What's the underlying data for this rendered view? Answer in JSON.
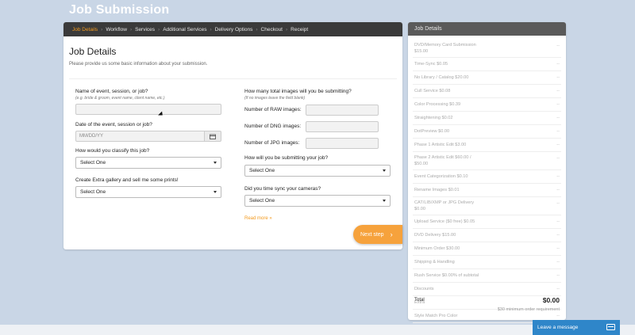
{
  "page": {
    "title": "Job Submission"
  },
  "tabs": [
    {
      "label": "Job Details",
      "active": true
    },
    {
      "label": "Workflow"
    },
    {
      "label": "Services"
    },
    {
      "label": "Additional Services"
    },
    {
      "label": "Delivery Options"
    },
    {
      "label": "Checkout"
    },
    {
      "label": "Receipt"
    }
  ],
  "details": {
    "title": "Job Details",
    "subtitle": "Please provide us some basic information about your submission."
  },
  "left": {
    "event_label": "Name of event, session, or job?",
    "event_hint": "(e.g. bride & groom, event name, client name, etc.)",
    "event_value": "",
    "date_label": "Date of the event, session or job?",
    "date_placeholder": "MM/DD/YY",
    "classify_label": "How would you classify this job?",
    "classify_value": "Select One",
    "gallery_label": "Create Extra gallery and sell me some prints!",
    "gallery_value": "Select One"
  },
  "right": {
    "images_label": "How many total images will you be submitting?",
    "images_hint": "(If no images leave the field blank)",
    "raw_label": "Number of RAW images:",
    "dng_label": "Number of DNG images:",
    "jpg_label": "Number of JPG images:",
    "submit_label": "How will you be submitting your job?",
    "submit_value": "Select One",
    "sync_label": "Did you time sync your cameras?",
    "sync_value": "Select One",
    "read_more": "Read more »"
  },
  "next_button": {
    "label": "Next step",
    "arrow": "›"
  },
  "sidebar": {
    "title": "Job Details",
    "services": [
      {
        "name": "DVD/Memory Card Submission",
        "price": "$15.00",
        "value": "--"
      },
      {
        "name": "Time-Sync $0.05",
        "value": "--"
      },
      {
        "name": "No Library / Catalog $20.00",
        "value": "--"
      },
      {
        "name": "Cull Service $0.08",
        "value": "--"
      },
      {
        "name": "Color Processing $0.39",
        "value": "--"
      },
      {
        "name": "Straightening $0.02",
        "value": "--"
      },
      {
        "name": "DotPreview $0.00",
        "value": "--"
      },
      {
        "name": "Phase 1 Artistic Edit $3.00",
        "value": "--"
      },
      {
        "name": "Phase 2 Artistic Edit $60.00 /",
        "price": "$50.00",
        "value": "--"
      },
      {
        "name": "Event Categorization $0.10",
        "value": "--"
      },
      {
        "name": "Rename Images $0.01",
        "value": "--"
      },
      {
        "name": "CAT/LIB/XMP or JPG Delivery",
        "price": "$0.00",
        "value": "--"
      },
      {
        "name": "Upload Service ($0 free) $0.05",
        "value": "--"
      },
      {
        "name": "DVD Delivery $15.00",
        "value": "--"
      },
      {
        "name": "Minimum Order $30.00",
        "value": "--"
      },
      {
        "name": "Shipping & Handling",
        "value": "--"
      },
      {
        "name": "Rush Service $0.00% of subtotal",
        "value": "--"
      },
      {
        "name": "Discounts",
        "value": "--"
      },
      {
        "name": "Extra",
        "value": "--"
      },
      {
        "name": "Style Match Pro Color",
        "value": "--"
      }
    ],
    "total_label": "Total",
    "total_value": "$0.00",
    "min_requirement": "$30 minimum order requirement"
  },
  "chat": {
    "label": "Leave a message",
    "icon": "message-icon"
  },
  "colors": {
    "accent": "#f39a1e",
    "button": "#f6a23c",
    "background": "#c9d6e6",
    "chat": "#2f86c9"
  }
}
